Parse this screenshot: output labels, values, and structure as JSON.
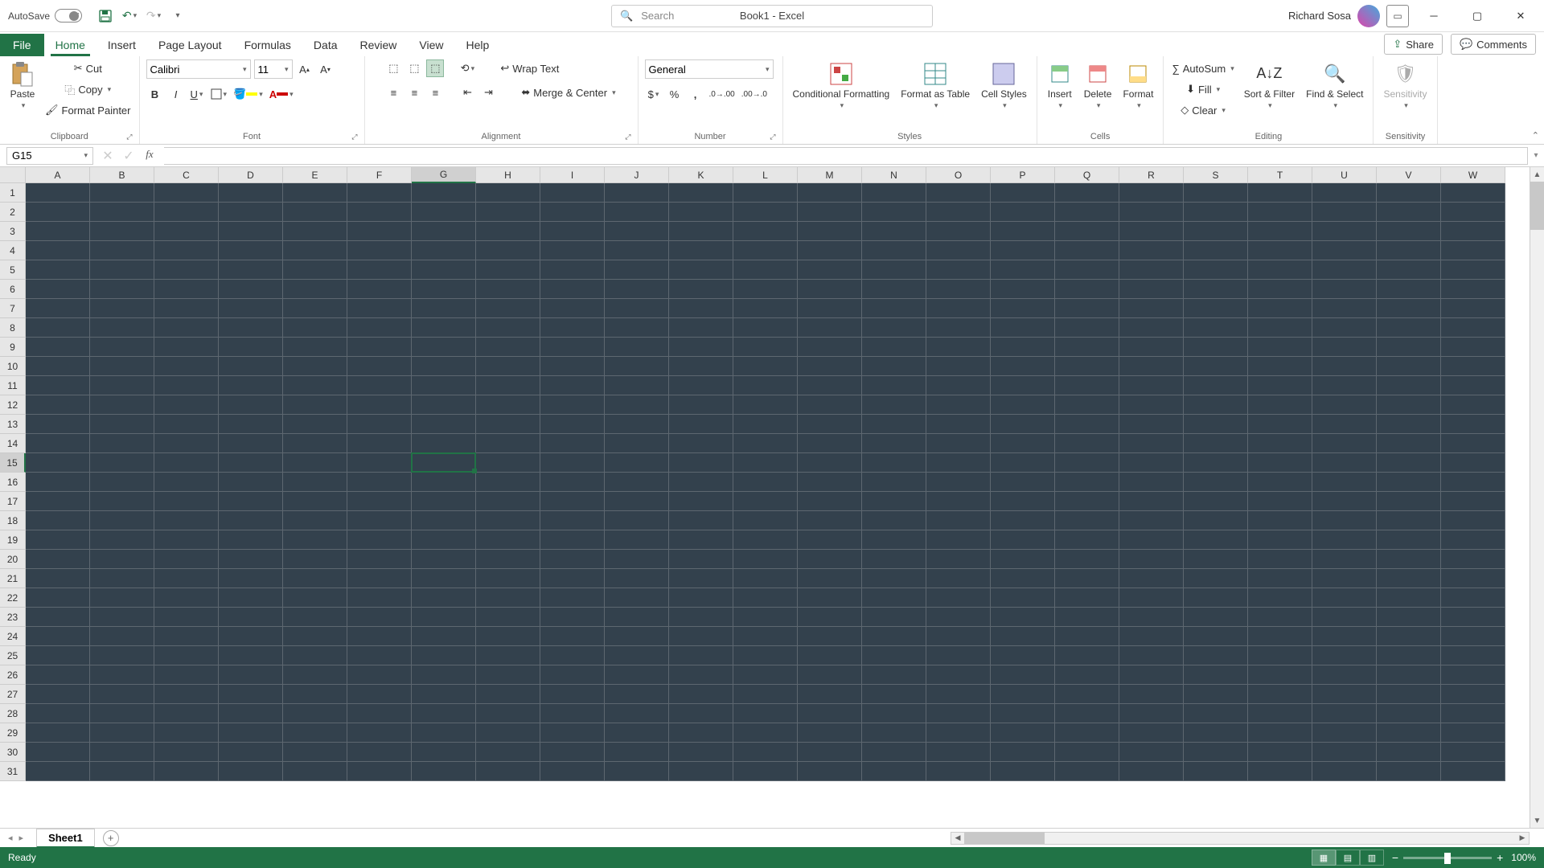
{
  "titlebar": {
    "autosave_label": "AutoSave",
    "autosave_state": "Off",
    "title": "Book1 - Excel",
    "search_placeholder": "Search",
    "user": "Richard Sosa"
  },
  "tabs": {
    "file": "File",
    "items": [
      "Home",
      "Insert",
      "Page Layout",
      "Formulas",
      "Data",
      "Review",
      "View",
      "Help"
    ],
    "active": "Home",
    "share": "Share",
    "comments": "Comments"
  },
  "ribbon": {
    "clipboard": {
      "paste": "Paste",
      "cut": "Cut",
      "copy": "Copy",
      "format_painter": "Format Painter",
      "label": "Clipboard"
    },
    "font": {
      "name": "Calibri",
      "size": "11",
      "label": "Font"
    },
    "alignment": {
      "wrap": "Wrap Text",
      "merge": "Merge & Center",
      "label": "Alignment"
    },
    "number": {
      "format": "General",
      "label": "Number"
    },
    "styles": {
      "cond": "Conditional Formatting",
      "fat": "Format as Table",
      "cell": "Cell Styles",
      "label": "Styles"
    },
    "cells": {
      "insert": "Insert",
      "delete": "Delete",
      "format": "Format",
      "label": "Cells"
    },
    "editing": {
      "autosum": "AutoSum",
      "fill": "Fill",
      "clear": "Clear",
      "sort": "Sort & Filter",
      "find": "Find & Select",
      "label": "Editing"
    },
    "sensitivity": {
      "btn": "Sensitivity",
      "label": "Sensitivity"
    }
  },
  "formula_bar": {
    "namebox": "G15",
    "value": ""
  },
  "grid": {
    "columns": [
      "A",
      "B",
      "C",
      "D",
      "E",
      "F",
      "G",
      "H",
      "I",
      "J",
      "K",
      "L",
      "M",
      "N",
      "O",
      "P",
      "Q",
      "R",
      "S",
      "T",
      "U",
      "V",
      "W"
    ],
    "rows": 31,
    "selected_col": "G",
    "selected_row": 15
  },
  "sheets": {
    "active": "Sheet1"
  },
  "status": {
    "ready": "Ready",
    "zoom": "100%"
  }
}
